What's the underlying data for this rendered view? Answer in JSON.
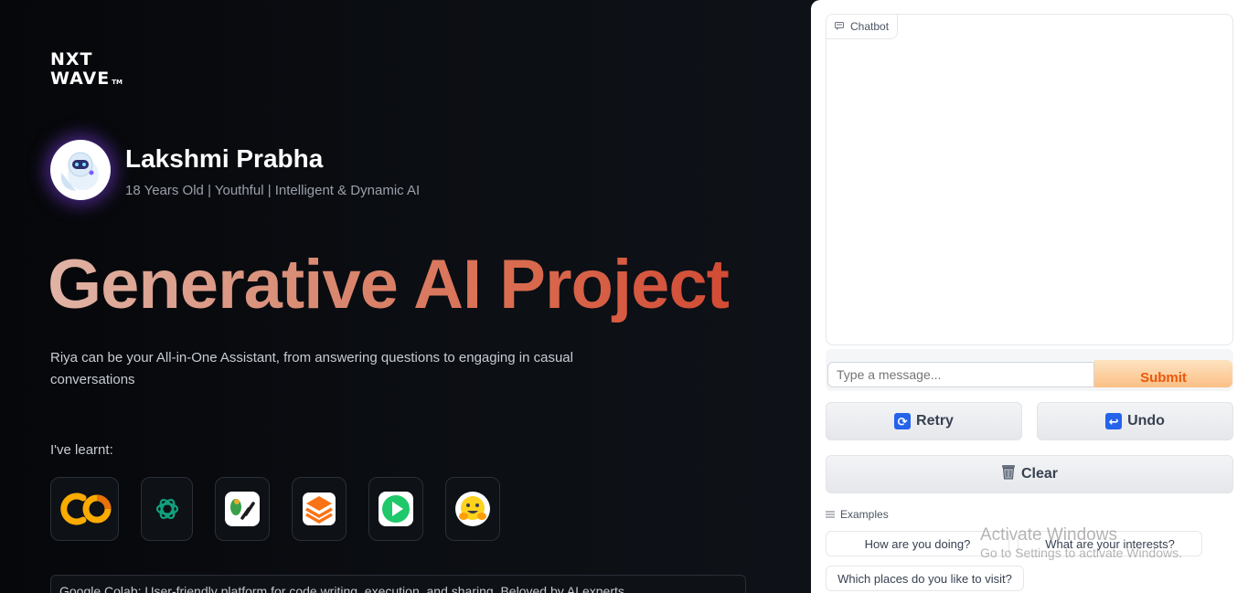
{
  "brand": {
    "line1": "NXT",
    "line2": "WAVE",
    "tm": "TM"
  },
  "profile": {
    "name": "Lakshmi Prabha",
    "tagline": "18 Years Old | Youthful | Intelligent & Dynamic AI",
    "avatar_icon": "robot-icon"
  },
  "headline": "Generative AI Project",
  "description": "Riya can be your All-in-One Assistant, from answering questions to engaging in casual conversations",
  "learnt_label": "I've learnt:",
  "tools": [
    {
      "name": "google-colab-icon",
      "label": "CO"
    },
    {
      "name": "openai-icon"
    },
    {
      "name": "langchain-icon"
    },
    {
      "name": "stack-icon"
    },
    {
      "name": "play-icon"
    },
    {
      "name": "hugging-face-icon"
    }
  ],
  "info_text": "Google Colab: User-friendly platform for code writing, execution, and sharing. Beloved by AI experts.",
  "chat": {
    "label": "Chatbot",
    "input_placeholder": "Type a message...",
    "submit": "Submit",
    "retry": "Retry",
    "undo": "Undo",
    "clear": "Clear",
    "examples_label": "Examples",
    "examples": [
      "How are you doing?",
      "What are your interests?",
      "Which places do you like to visit?"
    ]
  },
  "watermark": {
    "title": "Activate Windows",
    "subtitle": "Go to Settings to activate Windows."
  },
  "colors": {
    "accent": "#ea580c",
    "headline_start": "#e0b4a6",
    "headline_end": "#d24b35"
  }
}
